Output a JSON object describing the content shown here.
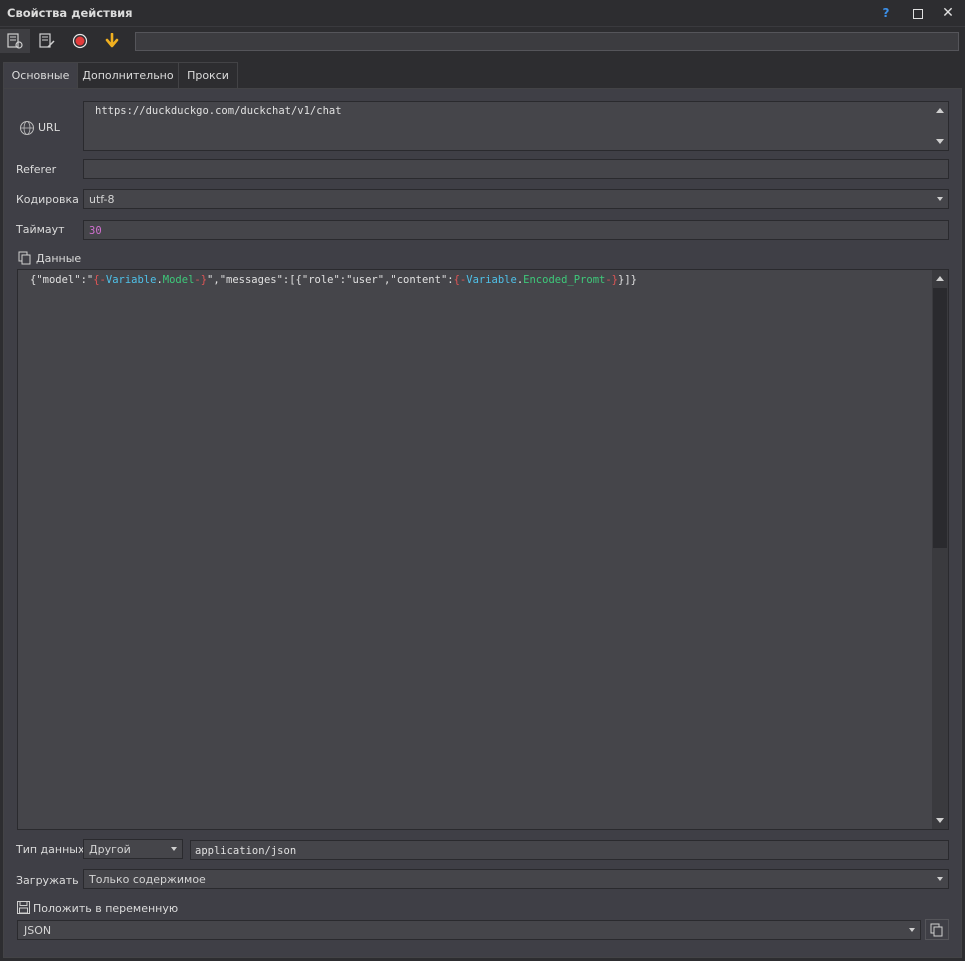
{
  "window": {
    "title": "Свойства действия",
    "help_glyph": "?",
    "close_glyph": "✕"
  },
  "toolbar": {
    "icons": [
      "properties-settings-icon",
      "properties-edit-icon",
      "record-icon",
      "download-arrow-icon"
    ],
    "name_value": ""
  },
  "tabs": [
    {
      "label": "Основные",
      "active": true
    },
    {
      "label": "Дополнительно",
      "active": false
    },
    {
      "label": "Прокси",
      "active": false
    }
  ],
  "form": {
    "url_label": "URL",
    "url_value": "https://duckduckgo.com/duckchat/v1/chat",
    "referer_label": "Referer",
    "referer_value": "",
    "encoding_label": "Кодировка",
    "encoding_value": "utf-8",
    "timeout_label": "Таймаут",
    "timeout_value": "30",
    "data_label": "Данные",
    "data_tokens": {
      "t1": "{\"model\":\"",
      "t2": "{-",
      "t3": "Variable",
      "t4": ".",
      "t5": "Model",
      "t6": "-}",
      "t7": "\",\"messages\":[{\"role\":\"user\",\"content\":",
      "t8": "{-",
      "t9": "Variable",
      "t10": ".",
      "t11": "Encoded_Promt",
      "t12": "-}",
      "t13": "}]}"
    },
    "content_type_label": "Тип данных",
    "content_type_value": "Другой",
    "content_type_mime": "application/json",
    "load_label": "Загружать",
    "load_value": "Только содержимое",
    "save_var_label": "Положить в переменную",
    "save_var_value": "JSON"
  },
  "colors": {
    "background": "#2d2d30",
    "panel": "#3f3f46",
    "field": "#45454a",
    "token_brace": "#e05555",
    "token_variable": "#4fc1e9",
    "token_name": "#3ec97a",
    "timeout_number": "#d070d0"
  }
}
